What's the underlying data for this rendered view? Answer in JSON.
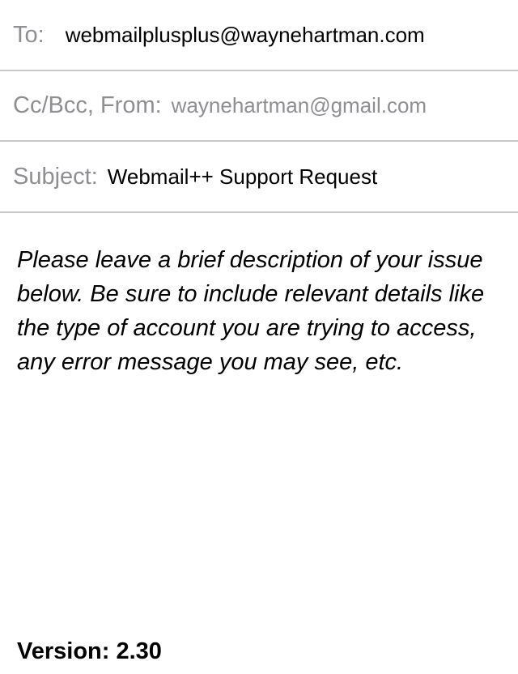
{
  "to": {
    "label": "To:",
    "value": "webmailplusplus@waynehartman.com"
  },
  "cc_from": {
    "label": "Cc/Bcc, From:",
    "value": "waynehartman@gmail.com"
  },
  "subject": {
    "label": "Subject:",
    "value": "Webmail++ Support Request"
  },
  "body": "Please leave a brief description of your issue below. Be sure to include relevant details like the type of account you are trying to access, any error message you may see, etc.",
  "version": "Version: 2.30"
}
